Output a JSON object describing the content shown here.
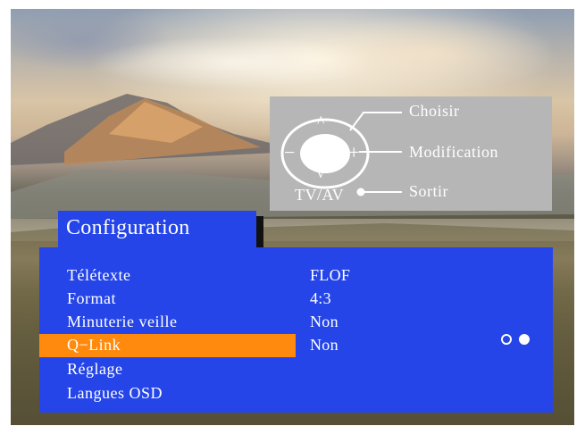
{
  "remote_legend": {
    "choose_label": "Choisir",
    "modify_label": "Modification",
    "exit_label": "Sortir",
    "tvav_label": "TV/AV",
    "up_symbol": "^",
    "down_symbol": "v",
    "minus_symbol": "−",
    "plus_symbol": "+"
  },
  "menu": {
    "title": "Configuration",
    "items": [
      {
        "label": "Télétexte",
        "value": "FLOF",
        "selected": false
      },
      {
        "label": "Format",
        "value": "4:3",
        "selected": false
      },
      {
        "label": "Minuterie veille",
        "value": "Non",
        "selected": false
      },
      {
        "label": "Q−Link",
        "value": "Non",
        "selected": true
      },
      {
        "label": "Réglage",
        "value": "",
        "selected": false
      },
      {
        "label": "Langues OSD",
        "value": "",
        "selected": false
      }
    ],
    "page_indicator": {
      "pages": 2,
      "current": 2
    }
  },
  "colors": {
    "menu_blue": "#2545e8",
    "highlight_orange": "#ff8a0e",
    "legend_grey": "#b6b6b6",
    "text": "#ffffff"
  }
}
